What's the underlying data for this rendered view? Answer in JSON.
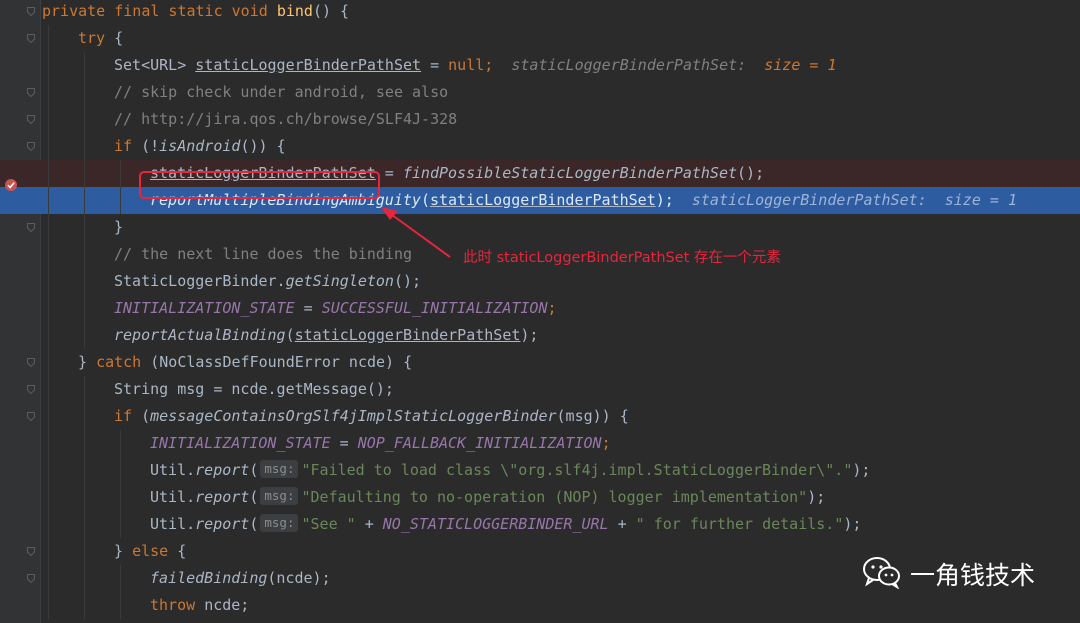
{
  "editor": {
    "lines": [
      {
        "segs": [
          [
            "kw",
            "private final static void "
          ],
          [
            "fn",
            "bind"
          ],
          [
            "",
            "() {"
          ]
        ]
      },
      {
        "segs": [
          [
            "kw",
            "try"
          ],
          [
            "",
            " {"
          ]
        ]
      },
      {
        "segs": [
          [
            "",
            "Set<URL> "
          ],
          [
            "ul",
            "staticLoggerBinderPathSet"
          ],
          [
            "",
            " = "
          ],
          [
            "kw",
            "null;"
          ],
          [
            "hint-val",
            "  staticLoggerBinderPathSet:  "
          ],
          [
            "hint-num",
            "size = 1"
          ]
        ]
      },
      {
        "segs": [
          [
            "cm",
            "// skip check under android, see also"
          ]
        ]
      },
      {
        "segs": [
          [
            "cm",
            "// http://jira.qos.ch/browse/SLF4J-328"
          ]
        ]
      },
      {
        "segs": [
          [
            "kw",
            "if "
          ],
          [
            "",
            "(!"
          ],
          [
            "it",
            "isAndroid"
          ],
          [
            "",
            "()) {"
          ]
        ]
      },
      {
        "segs": [
          [
            "ul",
            "staticLoggerBinderPathSet"
          ],
          [
            "",
            " = "
          ],
          [
            "it",
            "findPossibleStaticLoggerBinderPathSet"
          ],
          [
            "",
            "();"
          ]
        ]
      },
      {
        "segs": [
          [
            "it",
            "reportMultipleBindingAmbiguity"
          ],
          [
            "",
            "("
          ],
          [
            "ul",
            "staticLoggerBinderPathSet"
          ],
          [
            "",
            ");"
          ],
          [
            "hint-val",
            "  staticLoggerBinderPathSet:  size = 1"
          ]
        ]
      },
      {
        "segs": [
          [
            "",
            "}"
          ]
        ]
      },
      {
        "segs": [
          [
            "cm",
            "// the next line does the binding"
          ]
        ]
      },
      {
        "segs": [
          [
            "",
            "StaticLoggerBinder."
          ],
          [
            "it",
            "getSingleton"
          ],
          [
            "",
            "();"
          ]
        ]
      },
      {
        "segs": [
          [
            "fld",
            "INITIALIZATION_STATE"
          ],
          [
            "",
            " = "
          ],
          [
            "fld",
            "SUCCESSFUL_INITIALIZATION"
          ],
          [
            "kw",
            ";"
          ]
        ]
      },
      {
        "segs": [
          [
            "it",
            "reportActualBinding"
          ],
          [
            "",
            "("
          ],
          [
            "ul",
            "staticLoggerBinderPathSet"
          ],
          [
            "",
            ");"
          ]
        ]
      },
      {
        "segs": [
          [
            "",
            "} "
          ],
          [
            "kw",
            "catch "
          ],
          [
            "",
            "(NoClassDefFoundError ncde) {"
          ]
        ]
      },
      {
        "segs": [
          [
            "",
            "String msg = ncde.getMessage();"
          ]
        ]
      },
      {
        "segs": [
          [
            "kw",
            "if "
          ],
          [
            "",
            "("
          ],
          [
            "it",
            "messageContainsOrgSlf4jImplStaticLoggerBinder"
          ],
          [
            "",
            "(msg)) {"
          ]
        ]
      },
      {
        "segs": [
          [
            "fld",
            "INITIALIZATION_STATE"
          ],
          [
            "",
            " = "
          ],
          [
            "fld",
            "NOP_FALLBACK_INITIALIZATION"
          ],
          [
            "kw",
            ";"
          ]
        ]
      },
      {
        "segs": [
          [
            "",
            "Util."
          ],
          [
            "it",
            "report"
          ],
          [
            "",
            "("
          ],
          [
            "badge",
            "msg:"
          ],
          [
            "st",
            "\"Failed to load class \\\"org.slf4j.impl.StaticLoggerBinder\\\".\""
          ],
          [
            "",
            ");"
          ]
        ]
      },
      {
        "segs": [
          [
            "",
            "Util."
          ],
          [
            "it",
            "report"
          ],
          [
            "",
            "("
          ],
          [
            "badge",
            "msg:"
          ],
          [
            "st",
            "\"Defaulting to no-operation (NOP) logger implementation\""
          ],
          [
            "",
            ");"
          ]
        ]
      },
      {
        "segs": [
          [
            "",
            "Util."
          ],
          [
            "it",
            "report"
          ],
          [
            "",
            "("
          ],
          [
            "badge",
            "msg:"
          ],
          [
            "st",
            "\"See \""
          ],
          [
            "",
            " + "
          ],
          [
            "fld",
            "NO_STATICLOGGERBINDER_URL"
          ],
          [
            "",
            " + "
          ],
          [
            "st",
            "\" for further details.\""
          ],
          [
            "",
            ");"
          ]
        ]
      },
      {
        "segs": [
          [
            "",
            "} "
          ],
          [
            "kw",
            "else "
          ],
          [
            "",
            "{"
          ]
        ]
      },
      {
        "segs": [
          [
            "it",
            "failedBinding"
          ],
          [
            "",
            "(ncde);"
          ]
        ]
      },
      {
        "segs": [
          [
            "kw",
            "throw "
          ],
          [
            "",
            "ncde;"
          ]
        ]
      }
    ],
    "breakpoint_line": 7,
    "selected_line": 8
  },
  "annotation": {
    "text": "此时 staticLoggerBinderPathSet 存在一个元素",
    "color": "#e7253c"
  },
  "watermark": {
    "text": "一角钱技术",
    "icon": "wechat-icon"
  },
  "colors": {
    "background": "#2b2b2b",
    "keyword": "#cc7832",
    "method_decl": "#ffc66d",
    "comment": "#808080",
    "string": "#6a8759",
    "field": "#9876aa",
    "selection": "#2d5da0",
    "breakpoint_line": "#3b2728"
  }
}
